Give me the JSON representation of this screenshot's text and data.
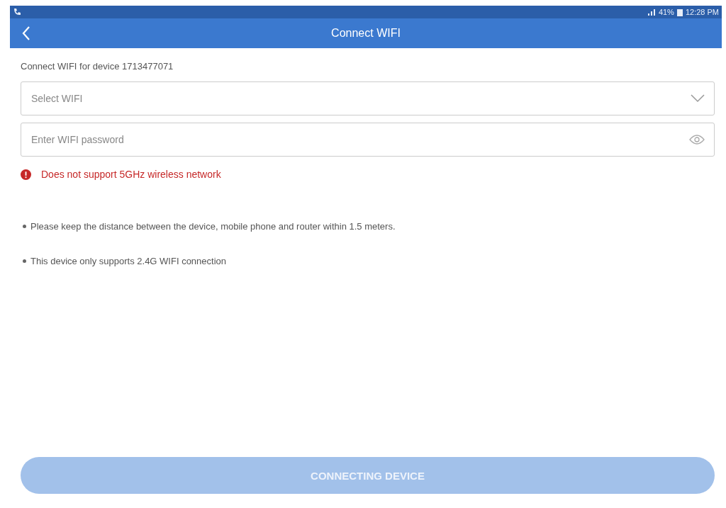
{
  "status_bar": {
    "battery": "41%",
    "time": "12:28 PM"
  },
  "header": {
    "title": "Connect WIFI"
  },
  "subtitle": "Connect WIFI for device 1713477071",
  "fields": [
    {
      "kind": "select",
      "placeholder": "Select WIFI"
    },
    {
      "kind": "password",
      "placeholder": "Enter WIFI password"
    }
  ],
  "error": "Does not support 5GHz wireless network",
  "tips": [
    "Please keep the distance between the device, mobile phone and router within 1.5 meters.",
    "This device only supports 2.4G WIFI connection"
  ],
  "button": {
    "label": "CONNECTING DEVICE",
    "disabled": true
  }
}
